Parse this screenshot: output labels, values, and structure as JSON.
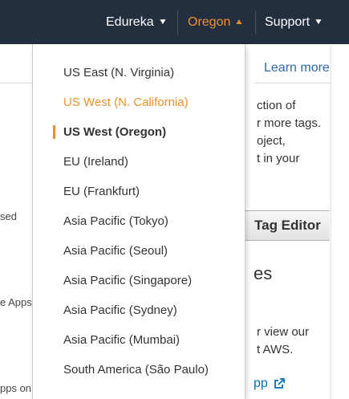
{
  "nav": {
    "account_label": "Edureka",
    "region_label": "Oregon",
    "support_label": "Support"
  },
  "region_menu": {
    "items": [
      {
        "label": "US East (N. Virginia)"
      },
      {
        "label": "US West (N. California)"
      },
      {
        "label": "US West (Oregon)"
      },
      {
        "label": "EU (Ireland)"
      },
      {
        "label": "EU (Frankfurt)"
      },
      {
        "label": "Asia Pacific (Tokyo)"
      },
      {
        "label": "Asia Pacific (Seoul)"
      },
      {
        "label": "Asia Pacific (Singapore)"
      },
      {
        "label": "Asia Pacific (Sydney)"
      },
      {
        "label": "Asia Pacific (Mumbai)"
      },
      {
        "label": "South America (São Paulo)"
      }
    ],
    "hovered_index": 1,
    "selected_index": 2
  },
  "background": {
    "learn_more": "Learn more",
    "paragraph_lines": [
      "ction of",
      "r more tags.",
      "oject,",
      "t in your"
    ],
    "tag_editor_button": "Tag Editor",
    "heading_fragment": "es",
    "paragraph2_lines": [
      "r view our",
      "t AWS."
    ],
    "app_link": "pp",
    "left_fragments": [
      "sed",
      "e Apps",
      "pps on"
    ]
  },
  "colors": {
    "topbar": "#232f3e",
    "accent": "#ec912d",
    "link": "#0073bb"
  }
}
